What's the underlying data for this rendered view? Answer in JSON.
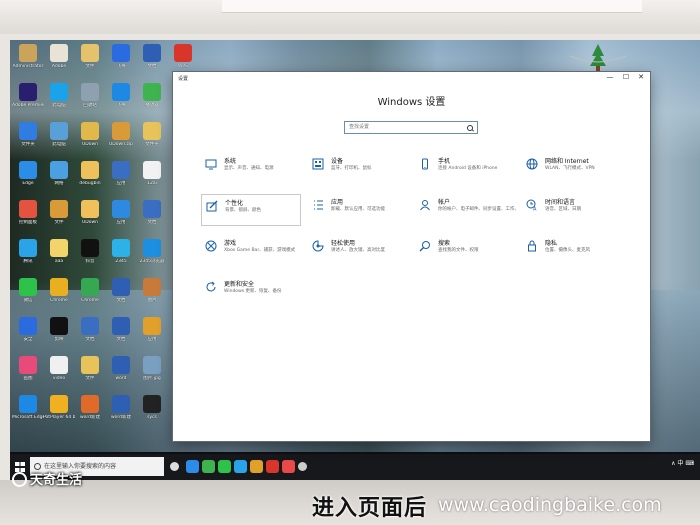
{
  "window": {
    "titlebar_label": "设置",
    "heading": "Windows 设置",
    "search_placeholder": "查找设置",
    "minimize": "—",
    "maximize": "☐",
    "close": "✕"
  },
  "tiles": [
    {
      "id": "system",
      "title": "系统",
      "subtitle": "显示、声音、通知、电源",
      "icon": "monitor-icon",
      "selected": false
    },
    {
      "id": "devices",
      "title": "设备",
      "subtitle": "蓝牙、打印机、鼠标",
      "icon": "keyboard-icon",
      "selected": false
    },
    {
      "id": "phone",
      "title": "手机",
      "subtitle": "连接 Android 设备和 iPhone",
      "icon": "phone-icon",
      "selected": false
    },
    {
      "id": "network",
      "title": "网络和 Internet",
      "subtitle": "WLAN、飞行模式、VPN",
      "icon": "globe-icon",
      "selected": false
    },
    {
      "id": "personalization",
      "title": "个性化",
      "subtitle": "背景、锁屏、颜色",
      "icon": "pen-icon",
      "selected": true
    },
    {
      "id": "apps",
      "title": "应用",
      "subtitle": "卸载、默认应用、可选功能",
      "icon": "list-icon",
      "selected": false
    },
    {
      "id": "accounts",
      "title": "帐户",
      "subtitle": "你的帐户、电子邮件、同步设置、工作、家庭",
      "icon": "person-icon",
      "selected": false
    },
    {
      "id": "time",
      "title": "时间和语言",
      "subtitle": "语音、区域、日期",
      "icon": "time-lang-icon",
      "selected": false
    },
    {
      "id": "gaming",
      "title": "游戏",
      "subtitle": "Xbox Game Bar、捕获、游戏模式",
      "icon": "xbox-icon",
      "selected": false
    },
    {
      "id": "ease",
      "title": "轻松使用",
      "subtitle": "讲述人、放大镜、高对比度",
      "icon": "ease-of-access-icon",
      "selected": false
    },
    {
      "id": "search",
      "title": "搜索",
      "subtitle": "查找我的文件、权限",
      "icon": "search-icon",
      "selected": false
    },
    {
      "id": "privacy",
      "title": "隐私",
      "subtitle": "位置、摄像头、麦克风",
      "icon": "lock-icon",
      "selected": false
    },
    {
      "id": "update",
      "title": "更新和安全",
      "subtitle": "Windows 更新、恢复、备份",
      "icon": "refresh-icon",
      "selected": false
    }
  ],
  "desktop_icons": [
    {
      "label": "Administrator",
      "color": "#c9a45a"
    },
    {
      "label": "Adobe",
      "color": "#e9e3d6"
    },
    {
      "label": "文件",
      "color": "#e6c26a"
    },
    {
      "label": "飞书",
      "color": "#2b6be0"
    },
    {
      "label": "文档",
      "color": "#2f5fb3"
    },
    {
      "label": "WPS",
      "color": "#d8362a"
    },
    {
      "label": "Adobe Premiere",
      "color": "#2a1f6e"
    },
    {
      "label": "此电脑",
      "color": "#1aa3e8"
    },
    {
      "label": "回收站",
      "color": "#8fa1b0"
    },
    {
      "label": "飞书",
      "color": "#1e88e5"
    },
    {
      "label": "播放器",
      "color": "#3fb34f"
    },
    {
      "label": "文件夹",
      "color": "#2f7de1"
    },
    {
      "label": "此电脑",
      "color": "#5aa0d8"
    },
    {
      "label": "UDown",
      "color": "#e0b94a"
    },
    {
      "label": "UDown.zip",
      "color": "#d99a38"
    },
    {
      "label": "文件夹",
      "color": "#e8c35a"
    },
    {
      "label": "Edge",
      "color": "#2b8de8"
    },
    {
      "label": "网络",
      "color": "#4aa0e0"
    },
    {
      "label": "debugbin",
      "color": "#f0c05a"
    },
    {
      "label": "应用",
      "color": "#3a6ec2"
    },
    {
      "label": "12ai",
      "color": "#f2f2f2"
    },
    {
      "label": "控制面板",
      "color": "#e25440"
    },
    {
      "label": "文件",
      "color": "#d99a38"
    },
    {
      "label": "UDown",
      "color": "#f0c05a"
    },
    {
      "label": "应用",
      "color": "#2e8ae0"
    },
    {
      "label": "文档",
      "color": "#3a6ec2"
    },
    {
      "label": "腾讯",
      "color": "#2ba3e8"
    },
    {
      "label": "aaa",
      "color": "#f2d46a"
    },
    {
      "label": "抖音",
      "color": "#111111"
    },
    {
      "label": "2345",
      "color": "#2cb2e8"
    },
    {
      "label": "2345浏览器",
      "color": "#1d8fe0"
    },
    {
      "label": "微信",
      "color": "#2dc24a"
    },
    {
      "label": "Chrome",
      "color": "#e8b020"
    },
    {
      "label": "Chrome",
      "color": "#36a852"
    },
    {
      "label": "文档",
      "color": "#2f5fb3"
    },
    {
      "label": "图片",
      "color": "#c87a3a"
    },
    {
      "label": "安全",
      "color": "#2b6be0"
    },
    {
      "label": "剪映",
      "color": "#111111"
    },
    {
      "label": "文档",
      "color": "#3a6ec2"
    },
    {
      "label": "文档",
      "color": "#2f5fb3"
    },
    {
      "label": "应用",
      "color": "#e0a02a"
    },
    {
      "label": "画图",
      "color": "#e84a7a"
    },
    {
      "label": "video",
      "color": "#f0f0f0"
    },
    {
      "label": "文件",
      "color": "#e8c35a"
    },
    {
      "label": "word",
      "color": "#2f5fb3"
    },
    {
      "label": "图片.jpg",
      "color": "#7a9fc0"
    },
    {
      "label": "Microsoft Edge",
      "color": "#1e88e5"
    },
    {
      "label": "PotPlayer 64 bit",
      "color": "#f0b020"
    },
    {
      "label": "word新建",
      "color": "#e06a2a"
    },
    {
      "label": "word新建",
      "color": "#2f5fb3"
    },
    {
      "label": "sycs",
      "color": "#222222"
    }
  ],
  "taskbar": {
    "search_placeholder": "在这里输入你要搜索的内容",
    "tray_text": "∧ 中 ⌨",
    "apps": [
      {
        "icon": "task-view-icon",
        "color": "#dddddd"
      },
      {
        "icon": "edge-icon",
        "color": "#2b8de8"
      },
      {
        "icon": "app-icon",
        "color": "#3fb34f"
      },
      {
        "icon": "app-icon",
        "color": "#2dc24a"
      },
      {
        "icon": "app-icon",
        "color": "#2ba3e8"
      },
      {
        "icon": "app-icon",
        "color": "#e0a02a"
      },
      {
        "icon": "app-icon",
        "color": "#d8362a"
      },
      {
        "icon": "app-icon",
        "color": "#e84a4a"
      },
      {
        "icon": "gear-icon",
        "color": "#cccccc"
      }
    ]
  },
  "overlay": {
    "logo_text": "天奇生活",
    "caption": "进入页面后",
    "site": "www.caodingbaike.com"
  }
}
